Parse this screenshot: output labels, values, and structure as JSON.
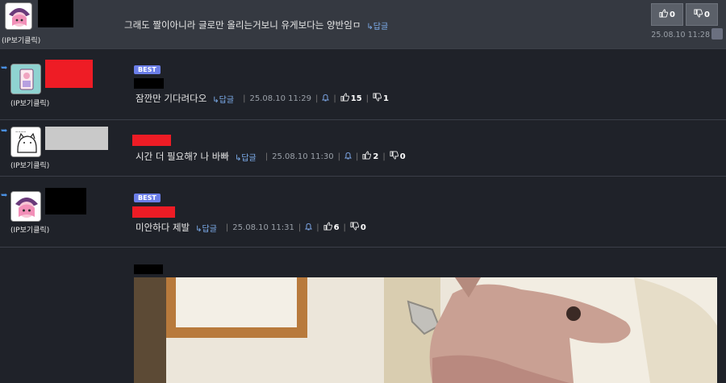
{
  "top_comment": {
    "ip_label": "(IP보기클릭)",
    "text": "그래도 짤이아니라 글로만 올리는거보니 유게보다는 양반임ㅁ",
    "reply_label": "↳답글",
    "upvotes": "0",
    "downvotes": "0",
    "timestamp": "25.08.10 11:28"
  },
  "comments": [
    {
      "ip_label": "(IP보기클릭)",
      "badge": "BEST",
      "text": "잠깐만 기다려다오",
      "reply_label": "↳답글",
      "timestamp": "25.08.10 11:29",
      "upvotes": "15",
      "downvotes": "1"
    },
    {
      "ip_label": "(IP보기클릭)",
      "text": "시간 더 필요해? 나 바빠",
      "reply_label": "↳답글",
      "timestamp": "25.08.10 11:30",
      "upvotes": "2",
      "downvotes": "0"
    },
    {
      "ip_label": "(IP보기클릭)",
      "badge": "BEST",
      "text": "미안하다 제발",
      "reply_label": "↳답글",
      "timestamp": "25.08.10 11:31",
      "upvotes": "6",
      "downvotes": "0"
    }
  ],
  "icons": {
    "reply_arrow": "↳",
    "thumb_up": "👍",
    "thumb_down": "👎",
    "bell": "bell-icon"
  },
  "colors": {
    "background": "#1f2229",
    "top_row": "#353941",
    "best_badge": "#6b7ee8",
    "reply_link": "#7fb0f0",
    "redaction_red": "#ee1c25"
  }
}
